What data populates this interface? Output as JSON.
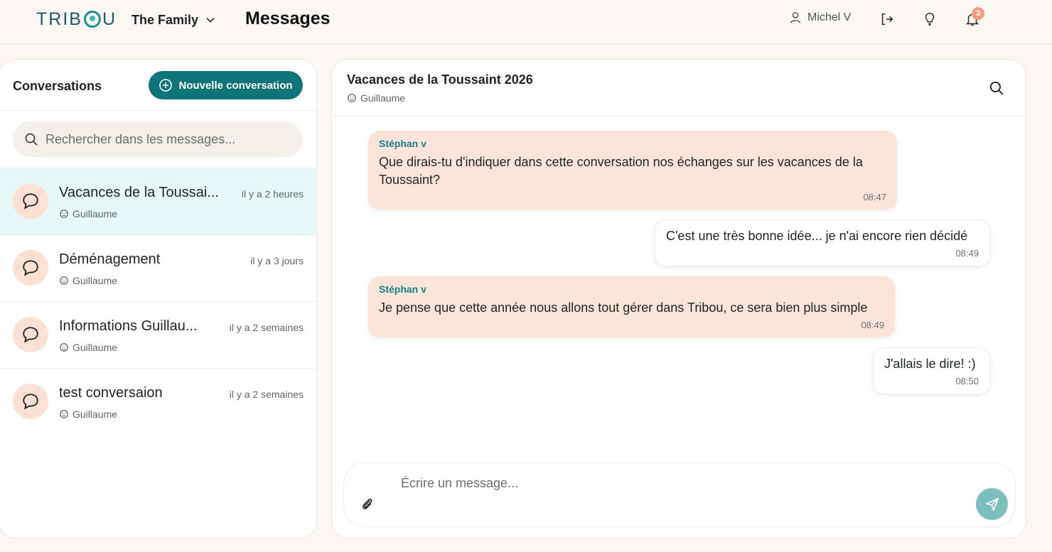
{
  "app": {
    "logo_text": "TRIBOU",
    "family_selector": "The Family",
    "page_title": "Messages"
  },
  "header": {
    "user_name": "Michel V",
    "notifications_count": "3",
    "icons": [
      "user-icon",
      "logout-icon",
      "lightbulb-icon",
      "bell-icon"
    ]
  },
  "sidebar": {
    "title": "Conversations",
    "new_conversation_label": "Nouvelle conversation",
    "search_placeholder": "Rechercher dans les messages...",
    "items": [
      {
        "name": "Vacances de la Toussai...",
        "time": "il y a 2 heures",
        "owner": "Guillaume",
        "active": true
      },
      {
        "name": "Déménagement",
        "time": "il y a 3 jours",
        "owner": "Guillaume",
        "active": false
      },
      {
        "name": "Informations Guillau...",
        "time": "il y a 2 semaines",
        "owner": "Guillaume",
        "active": false
      },
      {
        "name": "test conversaion",
        "time": "il y a 2 semaines",
        "owner": "Guillaume",
        "active": false
      }
    ]
  },
  "chat": {
    "title": "Vacances de la Toussaint 2026",
    "owner": "Guillaume",
    "messages": [
      {
        "sender": "Stéphan v",
        "text": "Que dirais-tu d'indiquer dans cette conversation nos échanges sur les vacances de la Toussaint?",
        "time": "08:47",
        "direction": "in"
      },
      {
        "sender": "",
        "text": "C'est une très bonne idée... je n'ai encore rien décidé",
        "time": "08:49",
        "direction": "out"
      },
      {
        "sender": "Stéphan v",
        "text": "Je pense que cette année nous allons tout gérer dans Tribou, ce sera bien plus simple",
        "time": "08:49",
        "direction": "in"
      },
      {
        "sender": "",
        "text": "J'allais le dire! :)",
        "time": "08:50",
        "direction": "out"
      }
    ],
    "composer_placeholder": "Écrire un message..."
  },
  "colors": {
    "accent": "#0f7479",
    "incoming_bubble": "#fde4da",
    "active_conversation": "#e8f8f9",
    "send_button": "#7dbfbf",
    "badge": "#f29b7e"
  }
}
